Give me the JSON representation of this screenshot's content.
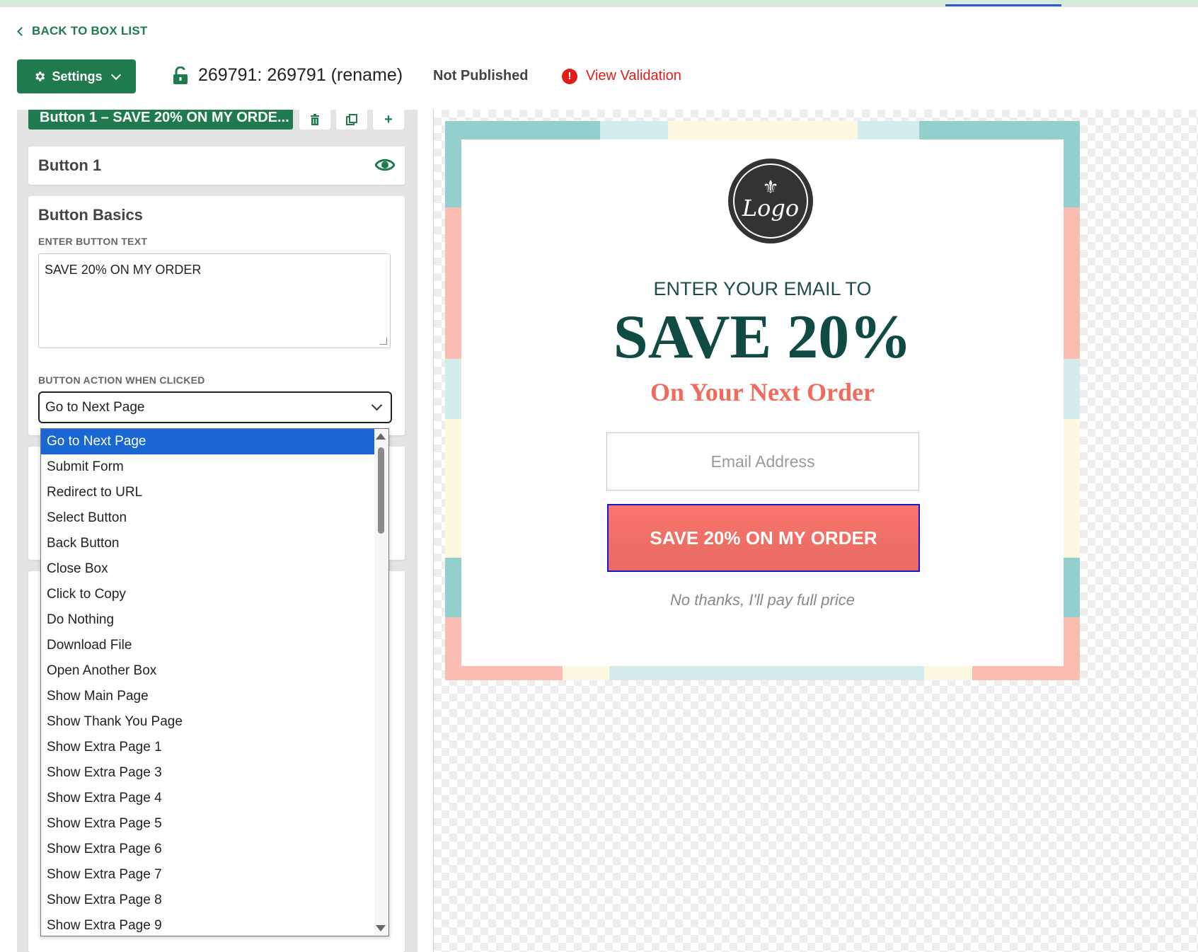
{
  "header": {
    "back_link": "BACK TO BOX LIST",
    "settings_label": "Settings",
    "box_title": "269791: 269791 (rename)",
    "status": "Not Published",
    "validation_label": "View Validation",
    "validation_icon": "!"
  },
  "editor": {
    "active_tab": "Button 1 – SAVE 20% ON MY ORDE...",
    "add_symbol": "+",
    "element_name": "Button 1",
    "section_title": "Button Basics",
    "text_label": "ENTER BUTTON TEXT",
    "button_text_value": "SAVE 20% ON MY ORDER",
    "action_label": "BUTTON ACTION WHEN CLICKED",
    "action_selected": "Go to Next Page",
    "action_options": [
      "Go to Next Page",
      "Submit Form",
      "Redirect to URL",
      "Select Button",
      "Back Button",
      "Close Box",
      "Click to Copy",
      "Do Nothing",
      "Download File",
      "Open Another Box",
      "Show Main Page",
      "Show Thank You Page",
      "Show Extra Page 1",
      "Show Extra Page 3",
      "Show Extra Page 4",
      "Show Extra Page 5",
      "Show Extra Page 6",
      "Show Extra Page 7",
      "Show Extra Page 8",
      "Show Extra Page 9"
    ]
  },
  "popup": {
    "logo_text": "Logo",
    "logo_symbol": "⚜",
    "lead": "ENTER YOUR EMAIL TO",
    "headline": "SAVE 20%",
    "subheadline": "On Your Next Order",
    "email_placeholder": "Email Address",
    "cta_label": "SAVE 20% ON MY ORDER",
    "decline_text": "No thanks, I'll pay full price"
  },
  "colors": {
    "brand_green": "#1f7a4d",
    "error_red": "#e21b1b",
    "headline_teal": "#0f4a45",
    "accent_coral": "#f26a5c",
    "border_teal": "#93cfcc",
    "border_pink": "#fbbdb1",
    "border_cream": "#fdf8e0",
    "border_light_teal": "#d3ecec",
    "select_highlight": "#1967d2"
  }
}
